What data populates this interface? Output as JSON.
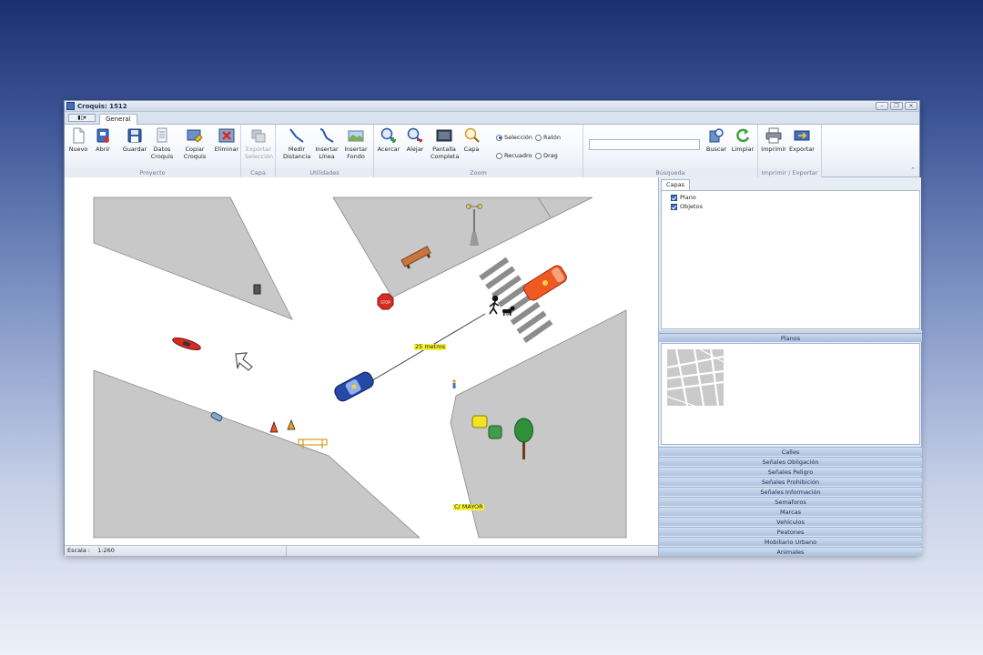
{
  "window": {
    "title": "Croquis: 1512",
    "min": "–",
    "restore": "❐",
    "close": "×"
  },
  "tabs": {
    "general": "General"
  },
  "ribbon": {
    "proyecto": {
      "label": "Proyecto",
      "nuevo": "Nuevo",
      "abrir": "Abrir",
      "guardar": "Guardar",
      "datos1": "Datos",
      "datos2": "Croquis",
      "copiar1": "Copiar",
      "copiar2": "Croquis",
      "eliminar": "Eliminar"
    },
    "capa": {
      "label": "Capa",
      "exportar1": "Exportar",
      "exportar2": "Selección"
    },
    "utilidades": {
      "label": "Utilidades",
      "medir1": "Medir",
      "medir2": "Distancia",
      "linea1": "Insertar",
      "linea2": "Línea",
      "fondo1": "Insertar",
      "fondo2": "Fondo"
    },
    "zoom": {
      "label": "Zoom",
      "acercar": "Acercar",
      "alejar": "Alejar",
      "pantalla1": "Pantalla",
      "pantalla2": "Completa",
      "capa": "Capa",
      "seleccion": "Selección",
      "raton": "Ratón",
      "recuadro": "Recuadro",
      "drag": "Drag"
    },
    "busqueda": {
      "label": "Búsqueda",
      "buscar": "Buscar",
      "limpiar": "Limpiar"
    },
    "imprimir": {
      "label": "Imprimir / Exportar",
      "imprimir": "Imprimir",
      "exportar": "Exportar"
    }
  },
  "canvas": {
    "distance_label": "25 metros",
    "street_label": "C/ MAYOR",
    "stop_sign": "STOP"
  },
  "status": {
    "escala_label": "Escala :",
    "escala_value": "1:260"
  },
  "panel": {
    "capas_tab": "Capas",
    "tree": [
      "Plano",
      "Objetos"
    ],
    "planos": "Planos",
    "categories": [
      "Calles",
      "Señales Obligación",
      "Señales Peligro",
      "Señales Prohibición",
      "Señales Información",
      "Semaforos",
      "Marcas",
      "Vehículos",
      "Peatones",
      "Mobiliario Urbano",
      "Animales"
    ]
  }
}
